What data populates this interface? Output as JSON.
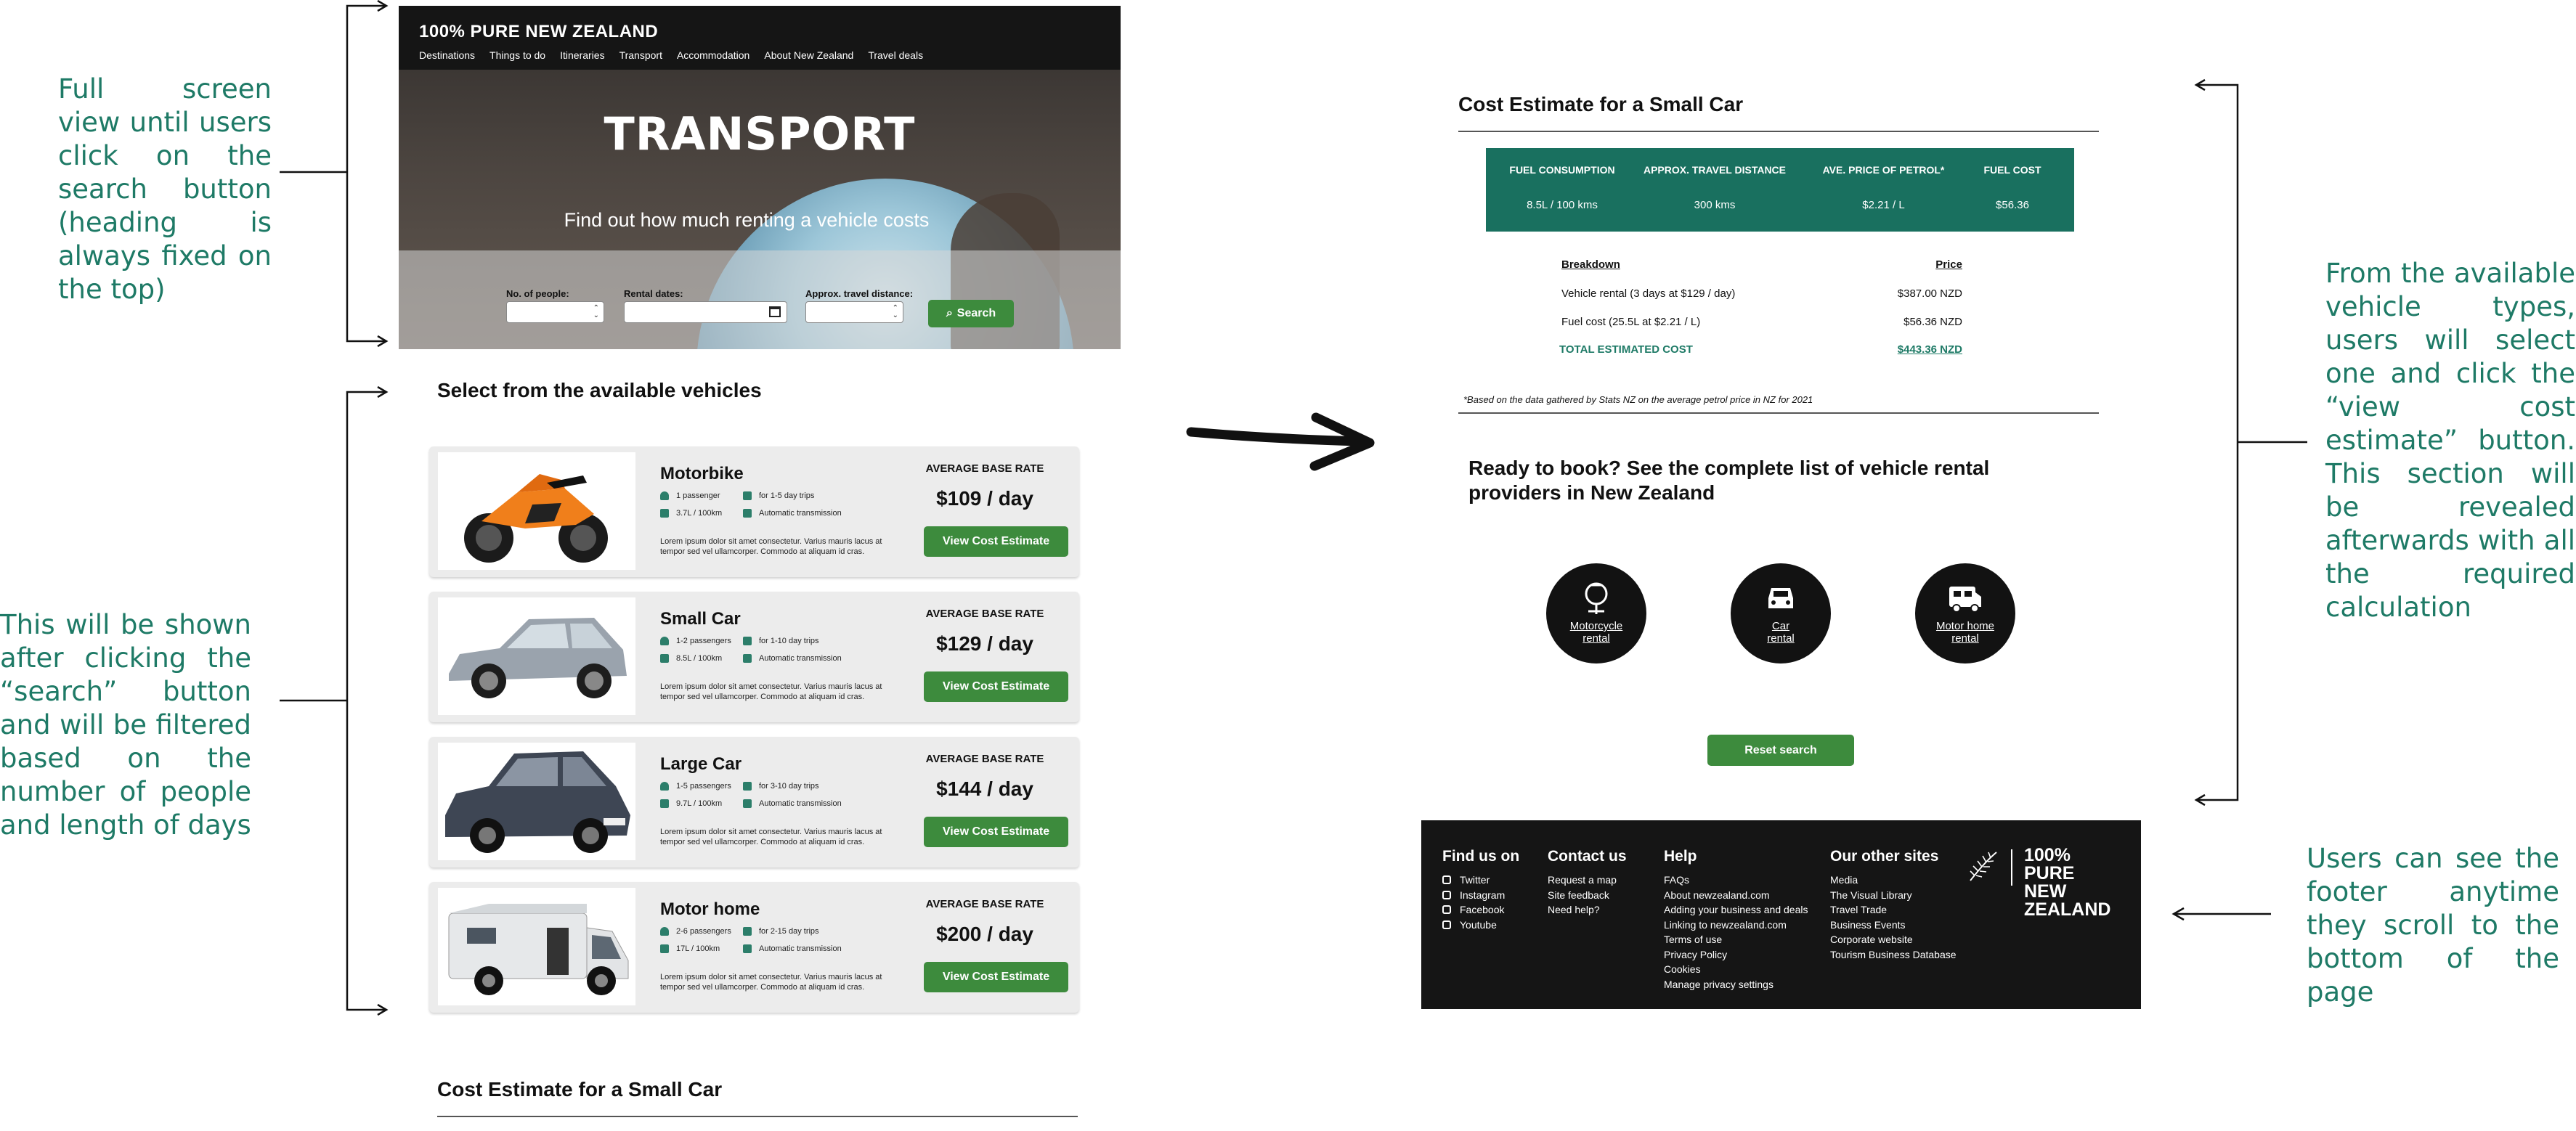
{
  "colors": {
    "annotation": "#1e7a66",
    "accent_green": "#3d8b3d",
    "teal_panel": "#19705f",
    "dark": "#151515"
  },
  "annotations": {
    "hero_note": "Full screen view until users click on the search button (heading is always fixed on the top)",
    "list_note": "This will be shown after clicking the “search” button and will be filtered based on the number of people and length of days",
    "estimate_note": "From the available vehicle types, users will select one and click the “view cost estimate” button. This section will be revealed afterwards with all the required calculation",
    "footer_note": "Users can see the footer anytime they scroll to the bottom of the page"
  },
  "header": {
    "brand": "100% PURE NEW ZEALAND",
    "nav": [
      "Destinations",
      "Things to do",
      "Itineraries",
      "Transport",
      "Accommodation",
      "About New Zealand",
      "Travel deals"
    ],
    "hero_title": "TRANSPORT",
    "hero_subtitle": "Find out how much renting a vehicle costs"
  },
  "search": {
    "people_label": "No. of people:",
    "dates_label": "Rental dates:",
    "distance_label": "Approx. travel distance:",
    "button": "Search",
    "button_icon": "search-icon"
  },
  "vehicles": {
    "section_title": "Select from the available vehicles",
    "items": [
      {
        "name": "Motorbike",
        "passengers": "1 passenger",
        "trips": "for 1-5 day trips",
        "fuel": "3.7L / 100km",
        "transmission": "Automatic transmission",
        "desc": "Lorem ipsum dolor sit amet consectetur. Varius mauris lacus at tempor sed vel ullamcorper. Commodo at aliquam id cras.",
        "rate_label": "AVERAGE BASE RATE",
        "price": "$109 / day",
        "button": "View Cost Estimate"
      },
      {
        "name": "Small Car",
        "passengers": "1-2 passengers",
        "trips": "for 1-10 day trips",
        "fuel": "8.5L / 100km",
        "transmission": "Automatic transmission",
        "desc": "Lorem ipsum dolor sit amet consectetur. Varius mauris lacus at tempor sed vel ullamcorper. Commodo at aliquam id cras.",
        "rate_label": "AVERAGE BASE RATE",
        "price": "$129 / day",
        "button": "View Cost Estimate"
      },
      {
        "name": "Large Car",
        "passengers": "1-5 passengers",
        "trips": "for 3-10 day trips",
        "fuel": "9.7L / 100km",
        "transmission": "Automatic transmission",
        "desc": "Lorem ipsum dolor sit amet consectetur. Varius mauris lacus at tempor sed vel ullamcorper. Commodo at aliquam id cras.",
        "rate_label": "AVERAGE BASE RATE",
        "price": "$144 / day",
        "button": "View Cost Estimate"
      },
      {
        "name": "Motor home",
        "passengers": "2-6 passengers",
        "trips": "for 2-15 day trips",
        "fuel": "17L / 100km",
        "transmission": "Automatic transmission",
        "desc": "Lorem ipsum dolor sit amet consectetur. Varius mauris lacus at tempor sed vel ullamcorper. Commodo at aliquam id cras.",
        "rate_label": "AVERAGE BASE RATE",
        "price": "$200 / day",
        "button": "View Cost Estimate"
      }
    ]
  },
  "estimate_preview_title": "Cost Estimate for a Small Car",
  "estimate": {
    "title": "Cost Estimate for a Small Car",
    "headers": [
      "FUEL CONSUMPTION",
      "APPROX. TRAVEL DISTANCE",
      "AVE. PRICE OF PETROL*",
      "FUEL COST"
    ],
    "values": [
      "8.5L / 100 kms",
      "300 kms",
      "$2.21 / L",
      "$56.36"
    ],
    "breakdown_label": "Breakdown",
    "price_label": "Price",
    "rows": [
      {
        "item": "Vehicle rental (3 days at $129 / day)",
        "price": "$387.00 NZD"
      },
      {
        "item": "Fuel cost (25.5L at $2.21 / L)",
        "price": "$56.36 NZD"
      }
    ],
    "total_label": "TOTAL ESTIMATED COST",
    "total": "$443.36 NZD",
    "footnote": "*Based on the data gathered by Stats NZ on the average petrol price in NZ for 2021"
  },
  "booking": {
    "heading": "Ready to book? See the complete list of vehicle rental providers in New Zealand",
    "options": [
      {
        "line1": "Motorcycle",
        "line2": "rental",
        "icon": "motorcycle-icon"
      },
      {
        "line1": "Car",
        "line2": "rental",
        "icon": "car-icon"
      },
      {
        "line1": "Motor home",
        "line2": "rental",
        "icon": "motorhome-icon"
      }
    ],
    "reset": "Reset search"
  },
  "footer": {
    "find_us": {
      "title": "Find us on",
      "links": [
        "Twitter",
        "Instagram",
        "Facebook",
        "Youtube"
      ]
    },
    "contact": {
      "title": "Contact us",
      "links": [
        "Request a map",
        "Site feedback",
        "Need help?"
      ]
    },
    "help": {
      "title": "Help",
      "links": [
        "FAQs",
        "About newzealand.com",
        "Adding your business and deals",
        "Linking to newzealand.com",
        "Terms of use",
        "Privacy Policy",
        "Cookies",
        "Manage privacy settings"
      ]
    },
    "other": {
      "title": "Our other sites",
      "links": [
        "Media",
        "The Visual Library",
        "Travel Trade",
        "Business Events",
        "Corporate website",
        "Tourism Business Database"
      ]
    },
    "logo_line1": "100% PURE",
    "logo_line2": "NEW ZEALAND"
  }
}
